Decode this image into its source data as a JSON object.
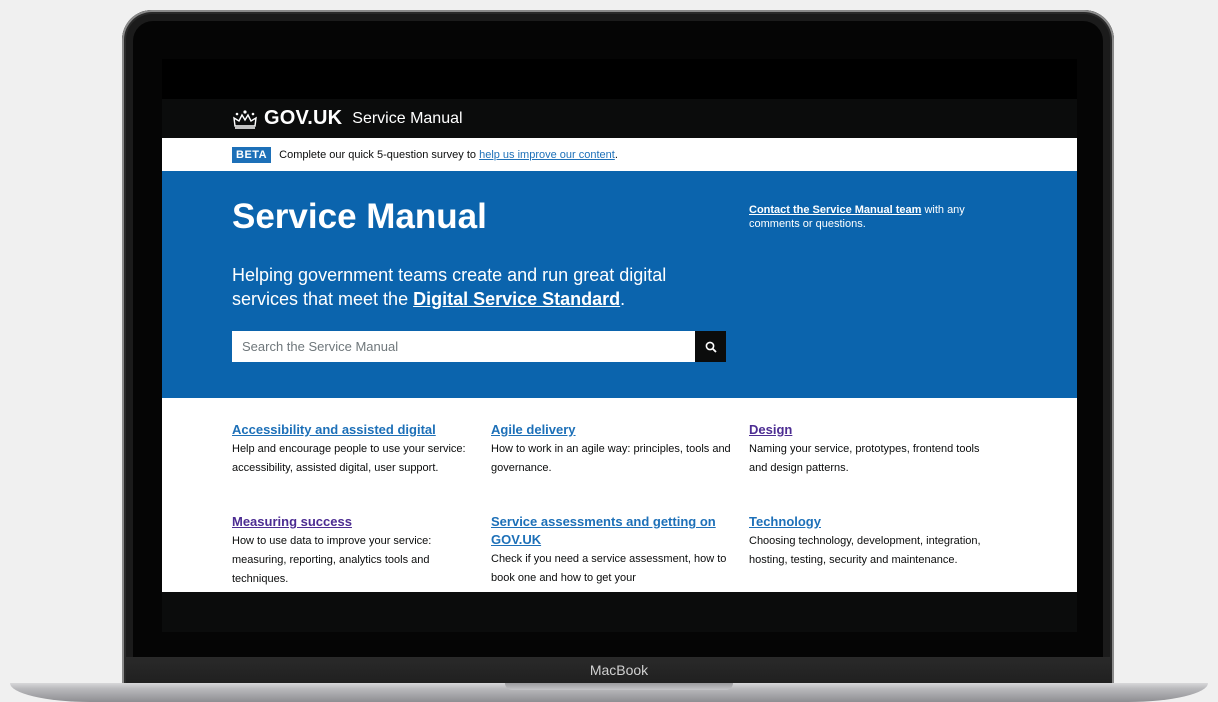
{
  "device": {
    "label": "MacBook"
  },
  "header": {
    "logo_text": "GOV.UK",
    "service_name": "Service Manual"
  },
  "beta_banner": {
    "tag": "BETA",
    "text": "Complete our quick 5-question survey to ",
    "link_text": "help us improve our content",
    "suffix": "."
  },
  "hero": {
    "title": "Service Manual",
    "subtitle_prefix": "Helping government teams create and run great digital services that meet the ",
    "subtitle_link": "Digital Service Standard",
    "subtitle_suffix": ".",
    "search": {
      "placeholder": "Search the Service Manual"
    },
    "contact_link": "Contact the Service Manual team",
    "contact_suffix": " with any comments or questions."
  },
  "topics": [
    {
      "title": "Accessibility and assisted digital",
      "description": "Help and encourage people to use your service: accessibility, assisted digital, user support."
    },
    {
      "title": "Agile delivery",
      "description": "How to work in an agile way: principles, tools and governance."
    },
    {
      "title": "Design",
      "description": "Naming your service, prototypes, frontend tools and design patterns."
    },
    {
      "title": "Measuring success",
      "description": "How to use data to improve your service: measuring, reporting, analytics tools and techniques."
    },
    {
      "title": "Service assessments and getting on GOV.UK",
      "description": "Check if you need a service assessment, how to book one and how to get your"
    },
    {
      "title": "Technology",
      "description": "Choosing technology, development, integration, hosting, testing, security and maintenance."
    }
  ],
  "colors": {
    "hero_blue": "#0b64ad",
    "link_blue": "#1d70b8",
    "visited_purple": "#4c2c92",
    "header_black": "#0b0c0c"
  }
}
